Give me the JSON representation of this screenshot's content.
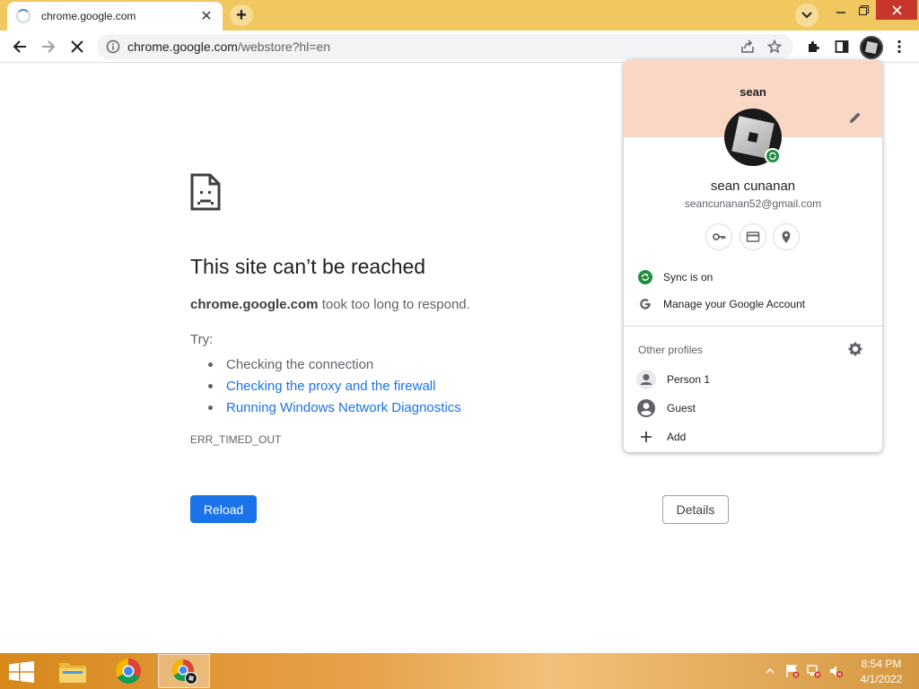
{
  "browser": {
    "tab_title": "chrome.google.com",
    "url_host": "chrome.google.com",
    "url_path": "/webstore?hl=en"
  },
  "error_page": {
    "title": "This site can’t be reached",
    "host": "chrome.google.com",
    "message": " took too long to respond.",
    "try_label": "Try:",
    "suggestions": [
      "Checking the connection",
      "Checking the proxy and the firewall",
      "Running Windows Network Diagnostics"
    ],
    "error_code": "ERR_TIMED_OUT",
    "reload_label": "Reload",
    "details_label": "Details"
  },
  "profile_menu": {
    "profile_name": "sean",
    "full_name": "sean cunanan",
    "email": "seancunanan52@gmail.com",
    "sync_label": "Sync is on",
    "manage_label": "Manage your Google Account",
    "other_profiles_label": "Other profiles",
    "profiles": [
      "Person 1",
      "Guest",
      "Add"
    ],
    "banner_color": "#fad7c4"
  },
  "taskbar": {
    "time": "8:54 PM",
    "date": "4/1/2022"
  },
  "colors": {
    "accent": "#1a73e8",
    "titlebar": "#f1c75f",
    "sync_green": "#1e8e3e"
  }
}
